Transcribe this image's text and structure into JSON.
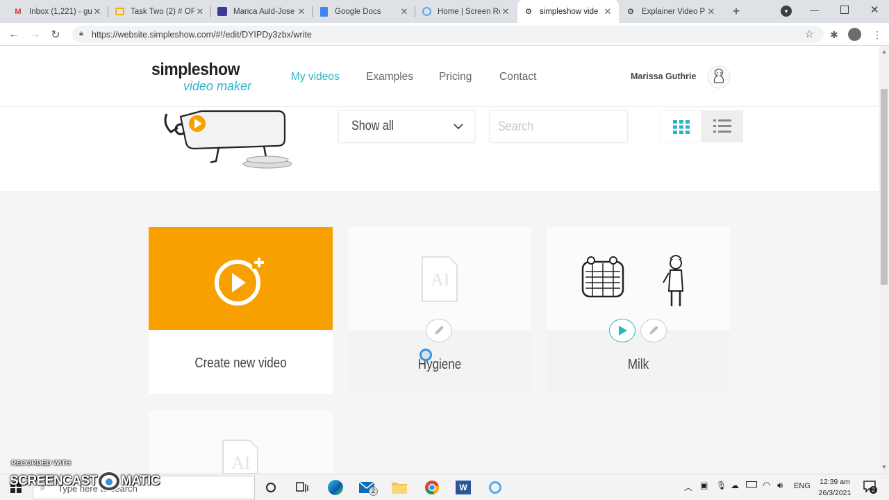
{
  "browser": {
    "tabs": [
      {
        "title": "Inbox (1,221) - gu",
        "favicon": "gmail-icon",
        "color": "#d93025"
      },
      {
        "title": "Task Two (2) # OF",
        "favicon": "slides-icon",
        "color": "#f4b400"
      },
      {
        "title": "Marica Auld-Jose",
        "favicon": "forms-icon",
        "color": "#3b3b98"
      },
      {
        "title": "Google Docs",
        "favicon": "docs-icon",
        "color": "#4285f4"
      },
      {
        "title": "Home | Screen Re",
        "favicon": "screencast-icon",
        "color": "#5aa9e6"
      },
      {
        "title": "simpleshow vide",
        "favicon": "simpleshow-icon",
        "color": "#333333"
      },
      {
        "title": "Explainer Video P",
        "favicon": "simpleshow-icon",
        "color": "#333333"
      }
    ],
    "url": "https://website.simpleshow.com/#!/edit/DYIPDy3zbx/write"
  },
  "site": {
    "logo_top": "simpleshow",
    "logo_bottom": "video maker",
    "nav": [
      "My videos",
      "Examples",
      "Pricing",
      "Contact"
    ],
    "user_name": "Marissa Guthrie",
    "accent": "#29b5c4",
    "orange": "#f7a000"
  },
  "filters": {
    "show_all": "Show all",
    "search_placeholder": "Search"
  },
  "cards": {
    "create": "Create new video",
    "videos": [
      {
        "title": "Hygiene"
      },
      {
        "title": "Milk"
      }
    ]
  },
  "watermark": {
    "line1": "RECORDED WITH",
    "line2a": "SCREENCAST",
    "line2b": "MATIC"
  },
  "taskbar": {
    "search": "Type here to search",
    "lang": "ENG",
    "time": "12:39 am",
    "date": "26/3/2021",
    "mail_badge": "2",
    "notif_badge": "2"
  }
}
